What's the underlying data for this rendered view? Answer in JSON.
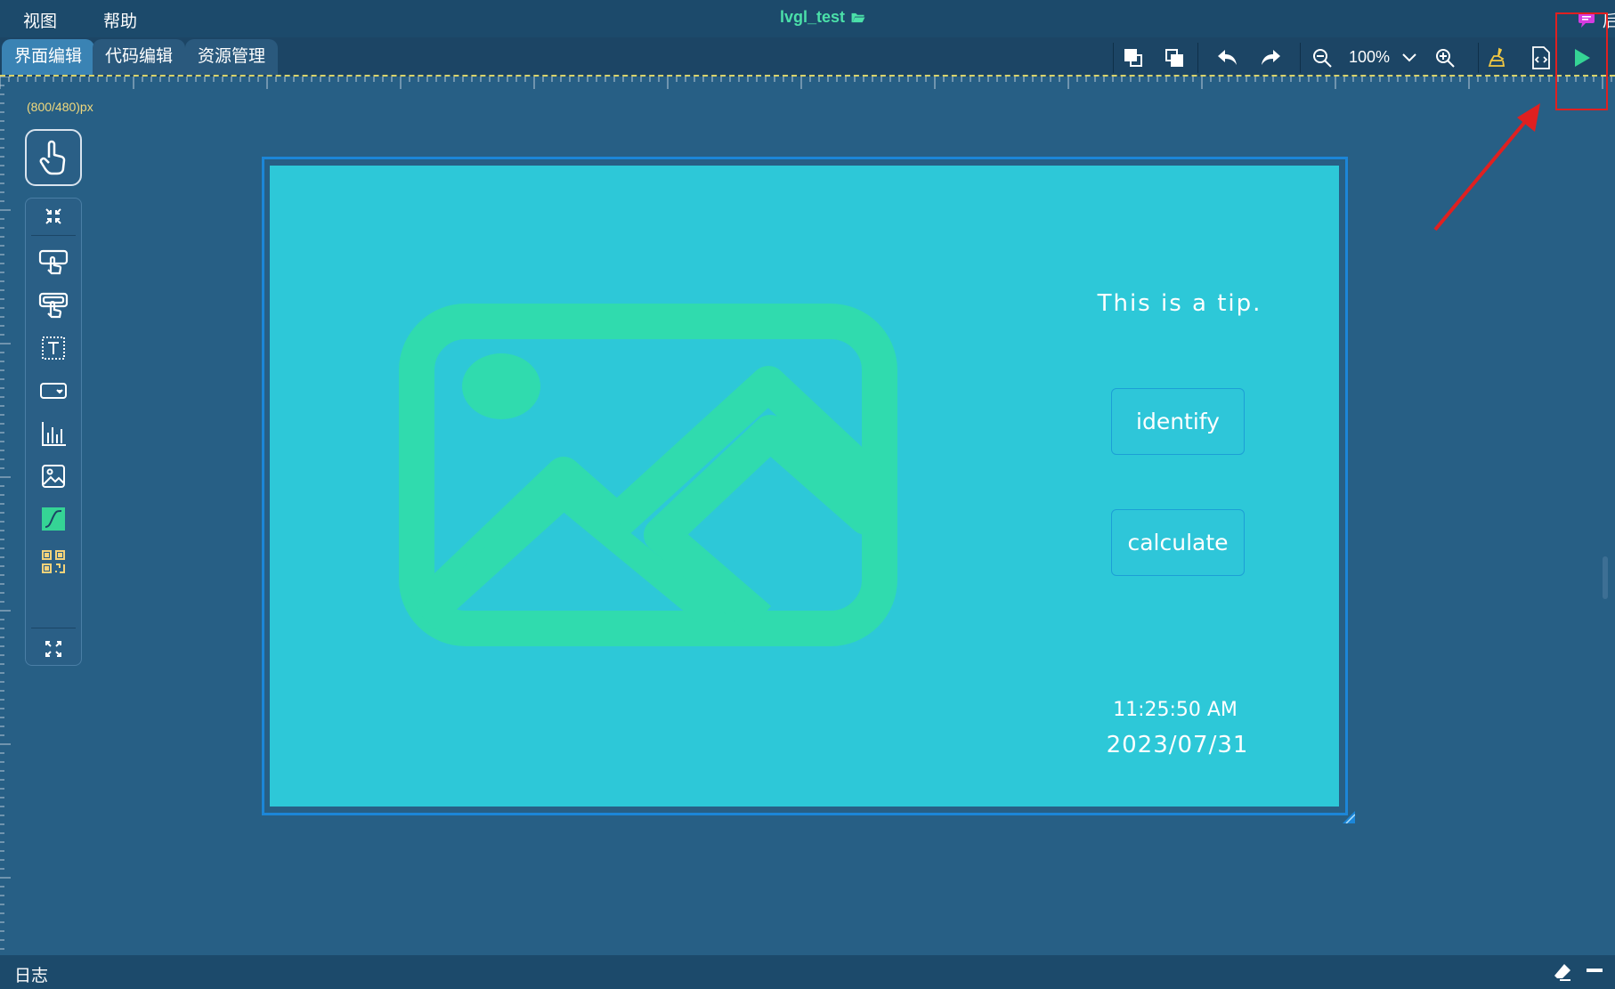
{
  "menu": {
    "view": "视图",
    "help": "帮助"
  },
  "app": {
    "title": "lvgl_test",
    "ghost_text": "后"
  },
  "tabs": [
    {
      "label": "界面编辑",
      "active": true
    },
    {
      "label": "代码编辑",
      "active": false
    },
    {
      "label": "资源管理",
      "active": false
    }
  ],
  "toolbar": {
    "zoom": "100%",
    "icons": [
      "bring-forward-icon",
      "send-backward-icon",
      "undo-icon",
      "redo-icon",
      "zoom-out-icon",
      "zoom-dropdown-icon",
      "zoom-in-icon",
      "clean-icon",
      "export-code-icon",
      "run-icon"
    ]
  },
  "canvas": {
    "size_label": "(800/480)px"
  },
  "palette": {
    "icons": [
      "pointer-icon",
      "collapse-icon",
      "container-icon",
      "button-widget-icon",
      "label-widget-icon",
      "dropdown-widget-icon",
      "chart-widget-icon",
      "image-widget-icon",
      "slider-widget-icon",
      "qrcode-widget-icon",
      "expand-icon"
    ]
  },
  "screen": {
    "tip": "This is a tip.",
    "identify_label": "identify",
    "calculate_label": "calculate",
    "time": "11:25:50 AM",
    "date": "2023/07/31"
  },
  "log": {
    "label": "日志"
  },
  "colors": {
    "background": "#275f85",
    "menubar": "#1c4a6b",
    "accent_green": "#4be0a9",
    "screen": "#2dc8d8",
    "placeholder_image": "#2fd8b0",
    "annotation_red": "#e02020"
  }
}
